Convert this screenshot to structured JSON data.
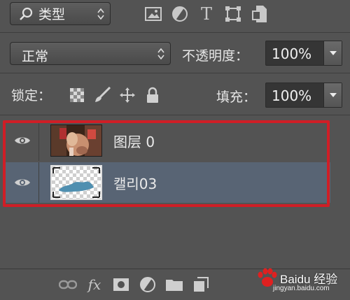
{
  "filter": {
    "kind_label": "类型"
  },
  "filter_icons": [
    "image-filter-icon",
    "adjustment-filter-icon",
    "type-filter-icon",
    "shape-filter-icon",
    "smart-object-filter-icon"
  ],
  "filter_text_icon": "T",
  "blend": {
    "mode": "正常",
    "opacity_label": "不透明度：",
    "opacity_value": "100%"
  },
  "lock": {
    "label": "锁定：",
    "fill_label": "填充：",
    "fill_value": "100%"
  },
  "layers": [
    {
      "name": "图层 0",
      "visible": true,
      "selected": false
    },
    {
      "name": "캘리03",
      "visible": true,
      "selected": true
    }
  ],
  "bottom_icons": [
    "link-icon",
    "fx-icon",
    "mask-icon",
    "adjustment-icon",
    "folder-icon",
    "new-layer-icon"
  ],
  "fx_label": "fx",
  "watermark": {
    "brand": "Baidu 经验",
    "url": "jingyan.baidu.com"
  },
  "colors": {
    "panel": "#535353",
    "selected_row": "#586474",
    "highlight_border": "#cf1e26"
  }
}
